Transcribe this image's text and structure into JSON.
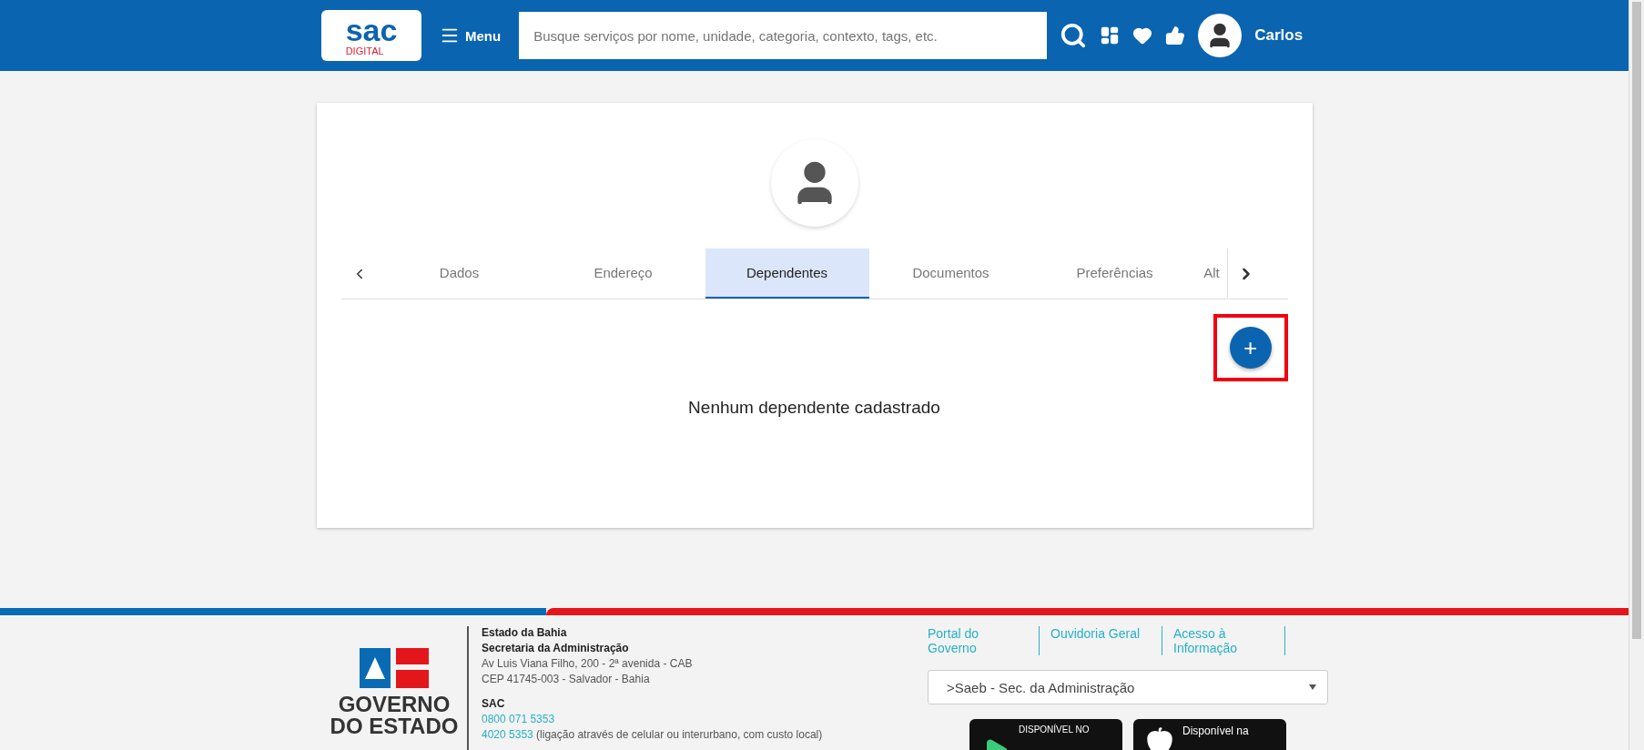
{
  "header": {
    "logo": {
      "main": "sac",
      "sub": "DIGITAL"
    },
    "menu_label": "Menu",
    "search": {
      "placeholder": "Busque serviços por nome, unidade, categoria, contexto, tags, etc."
    },
    "user": "Carlos"
  },
  "profile": {
    "tabs": [
      {
        "label": "Dados",
        "selected": false
      },
      {
        "label": "Endereço",
        "selected": false
      },
      {
        "label": "Dependentes",
        "selected": true
      },
      {
        "label": "Documentos",
        "selected": false
      },
      {
        "label": "Preferências",
        "selected": false
      },
      {
        "label": "Alt",
        "selected": false
      }
    ],
    "add_button": {
      "label": "+",
      "highlighted": true
    },
    "empty_message": "Nenhum dependente cadastrado"
  },
  "footer": {
    "logo": {
      "line1": "GOVERNO",
      "line2": "DO ESTADO"
    },
    "address": [
      {
        "text": "Estado da Bahia",
        "kind": "bold"
      },
      {
        "text": "Secretaria da Administração",
        "kind": "bold"
      },
      {
        "text": "Av Luis Viana Filho, 200 - 2ª avenida - CAB",
        "kind": "plain"
      },
      {
        "text": "CEP 41745-003 - Salvador - Bahia",
        "kind": "plain"
      }
    ],
    "sac_title": "SAC",
    "phones": [
      {
        "number": "0800 071 5353"
      },
      {
        "number": "4020 5353",
        "note": "(ligação através de celular ou interurbano, com custo local)"
      }
    ],
    "links": [
      "Portal do Governo",
      "Ouvidoria Geral",
      "Acesso à Informação"
    ],
    "select": {
      "value": ">Saeb - Sec. da Administração"
    },
    "stores": [
      {
        "kind": "google",
        "caption": "DISPONÍVEL NO"
      },
      {
        "kind": "apple",
        "caption": "Disponível na"
      }
    ]
  }
}
